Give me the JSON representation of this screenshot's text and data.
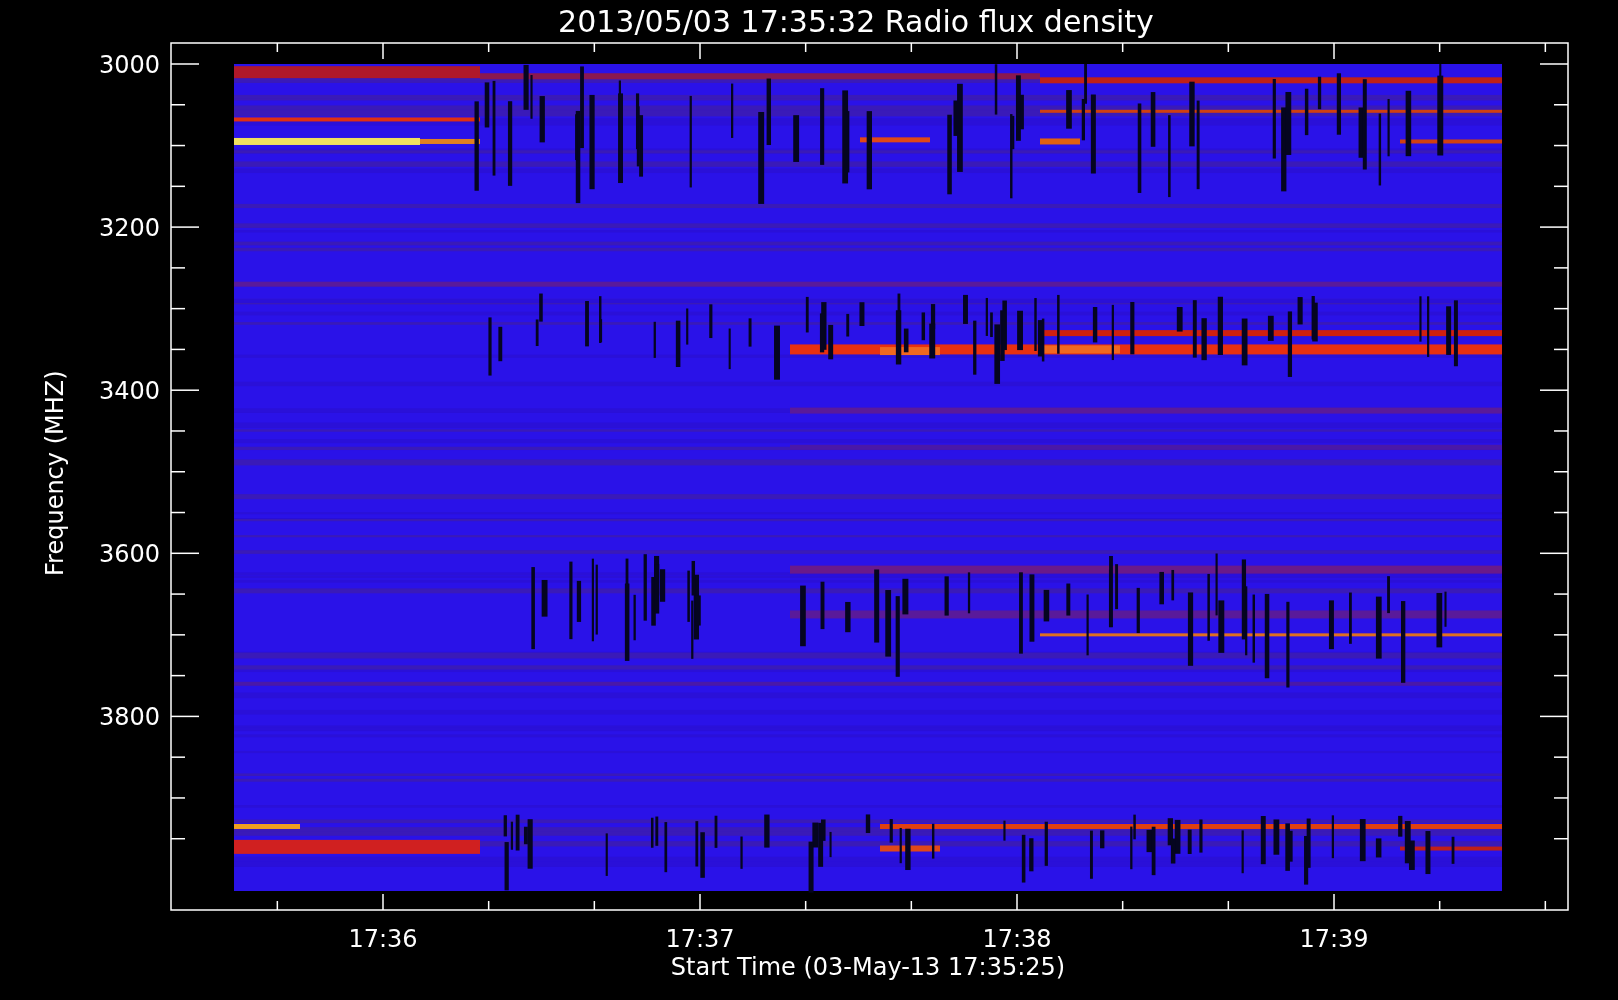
{
  "title": "2013/05/03 17:35:32 Radio flux density",
  "y_axis": {
    "label": "Frequency (MHZ)",
    "ticks": [
      "3000",
      "3200",
      "3400",
      "3600",
      "3800"
    ]
  },
  "x_axis": {
    "label": "Start Time (03-May-13 17:35:25)",
    "ticks": [
      "17:36",
      "17:37",
      "17:38",
      "17:39"
    ]
  }
}
